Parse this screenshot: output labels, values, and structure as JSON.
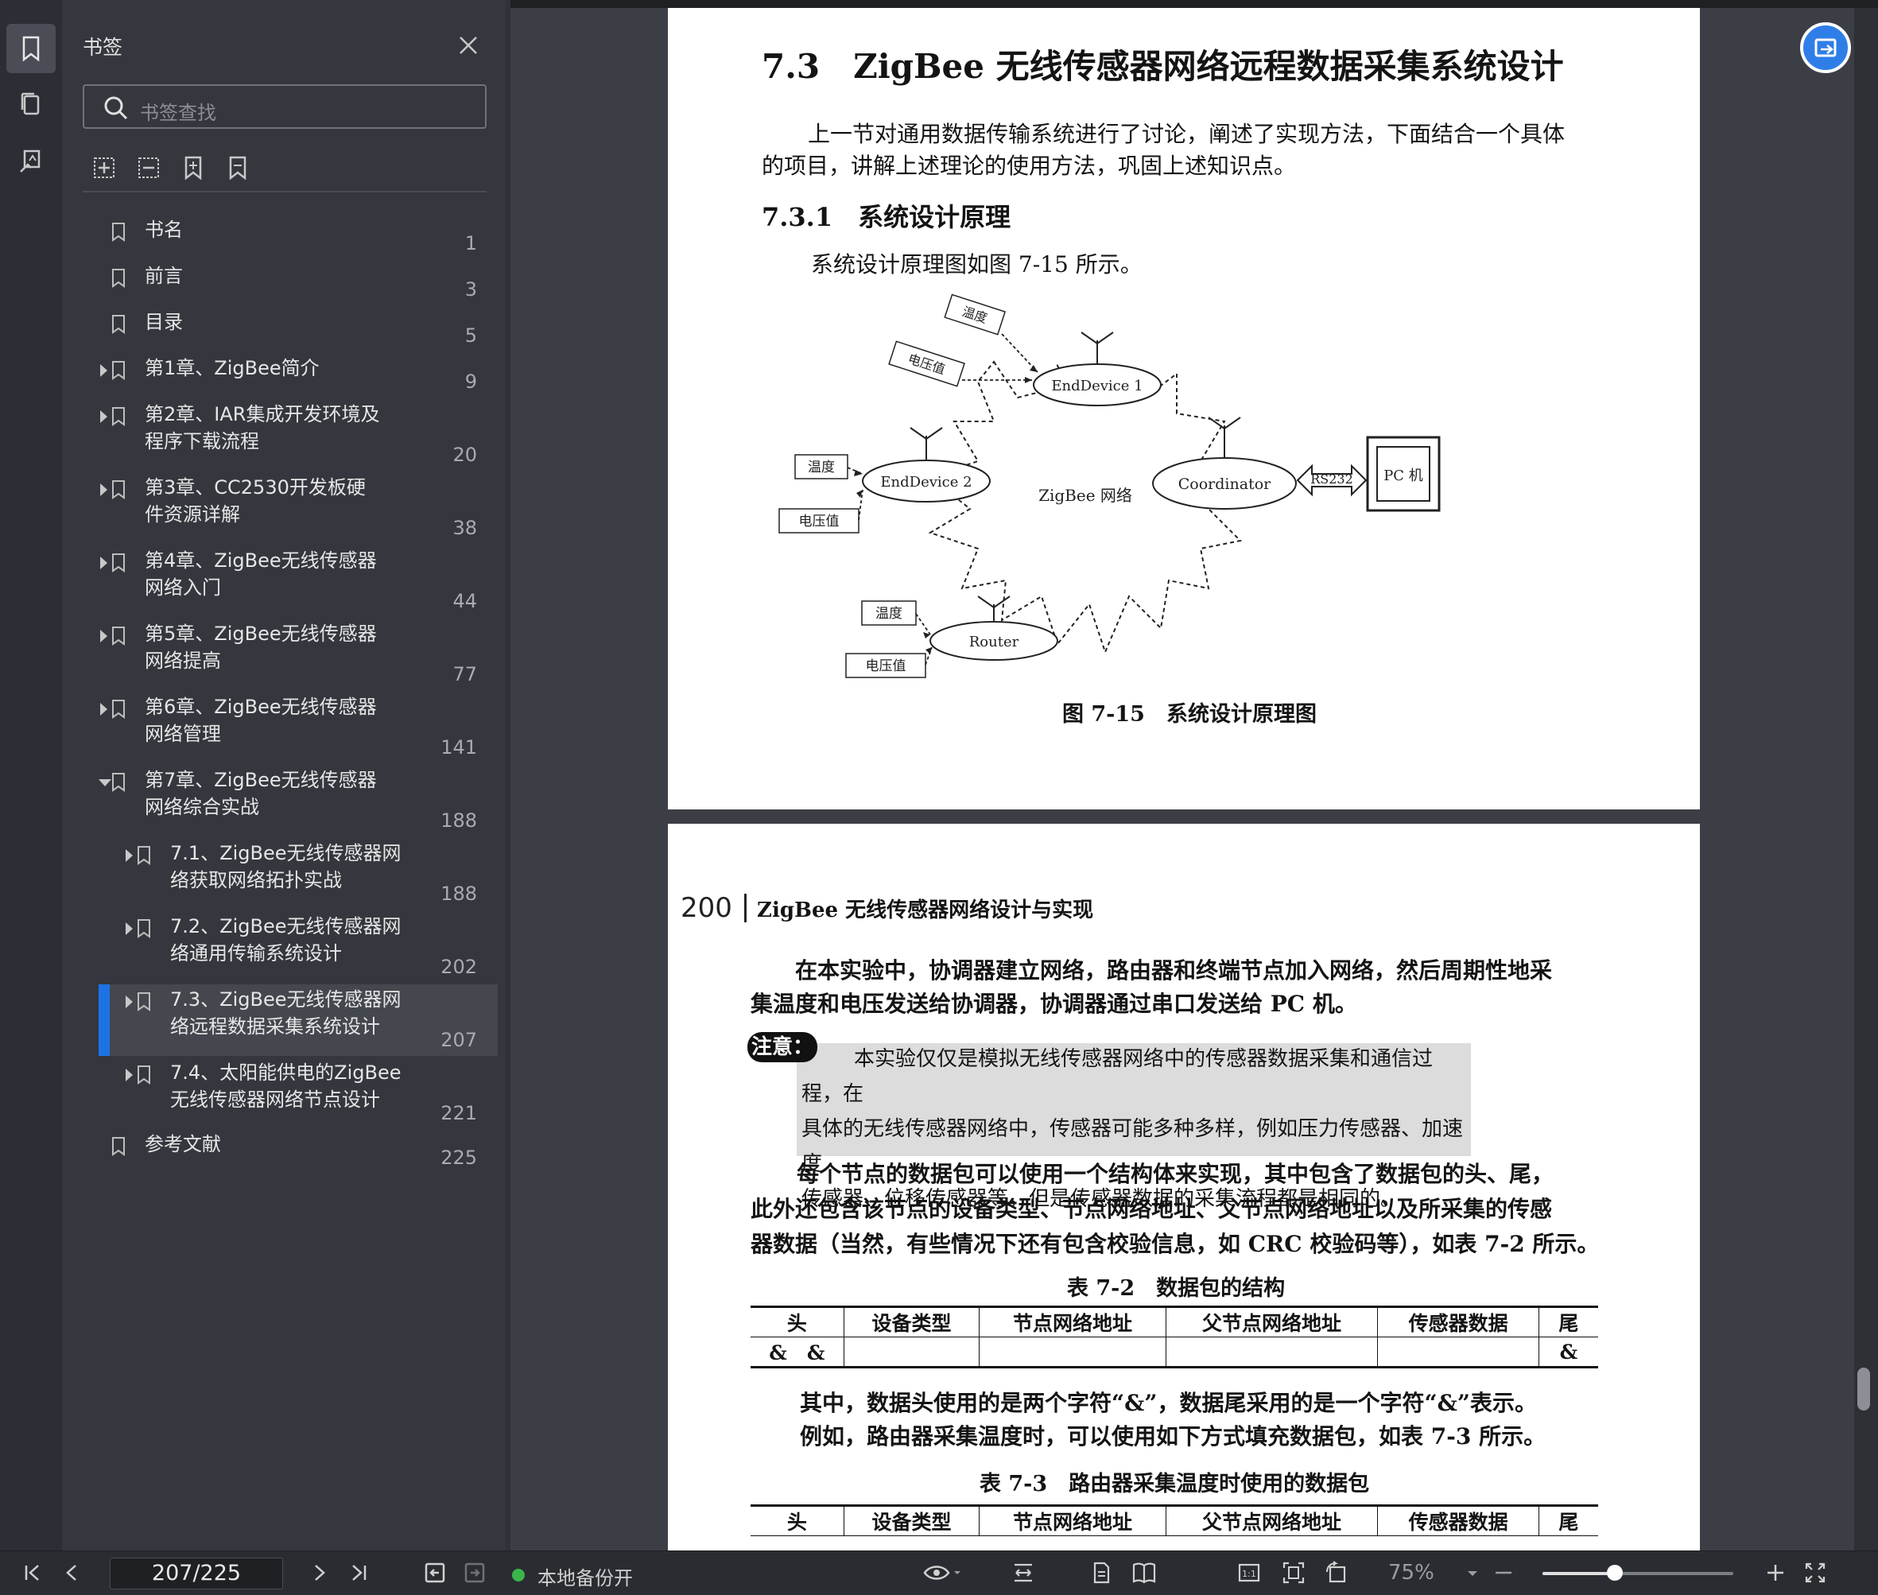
{
  "panel": {
    "title": "书签",
    "search_placeholder": "书签查找"
  },
  "bookmarks": [
    {
      "label": "书名",
      "page": "1",
      "expand": "none",
      "indent": 0
    },
    {
      "label": "前言",
      "page": "3",
      "expand": "none",
      "indent": 0
    },
    {
      "label": "目录",
      "page": "5",
      "expand": "none",
      "indent": 0
    },
    {
      "label": "第1章、ZigBee简介",
      "page": "9",
      "expand": "collapsed",
      "indent": 0
    },
    {
      "label": "第2章、IAR集成开发环境及程序下载流程",
      "page": "20",
      "expand": "collapsed",
      "indent": 0
    },
    {
      "label": "第3章、CC2530开发板硬件资源详解",
      "page": "38",
      "expand": "collapsed",
      "indent": 0
    },
    {
      "label": "第4章、ZigBee无线传感器网络入门",
      "page": "44",
      "expand": "collapsed",
      "indent": 0
    },
    {
      "label": "第5章、ZigBee无线传感器网络提高",
      "page": "77",
      "expand": "collapsed",
      "indent": 0
    },
    {
      "label": "第6章、ZigBee无线传感器网络管理",
      "page": "141",
      "expand": "collapsed",
      "indent": 0
    },
    {
      "label": "第7章、ZigBee无线传感器网络综合实战",
      "page": "188",
      "expand": "expanded",
      "indent": 0
    },
    {
      "label": "7.1、ZigBee无线传感器网络获取网络拓扑实战",
      "page": "188",
      "expand": "collapsed",
      "indent": 1
    },
    {
      "label": "7.2、ZigBee无线传感器网络通用传输系统设计",
      "page": "202",
      "expand": "collapsed",
      "indent": 1
    },
    {
      "label": "7.3、ZigBee无线传感器网络远程数据采集系统设计",
      "page": "207",
      "expand": "collapsed",
      "indent": 1,
      "selected": true
    },
    {
      "label": "7.4、太阳能供电的ZigBee无线传感器网络节点设计",
      "page": "221",
      "expand": "collapsed",
      "indent": 1
    },
    {
      "label": "参考文献",
      "page": "225",
      "expand": "none",
      "indent": 0
    }
  ],
  "doc": {
    "section_title": "7.3　ZigBee 无线传感器网络远程数据采集系统设计",
    "intro_line1": "上一节对通用数据传输系统进行了讨论，阐述了实现方法，下面结合一个具体",
    "intro_line2": "的项目，讲解上述理论的使用方法，巩固上述知识点。",
    "subsection_title": "7.3.1　系统设计原理",
    "fig_ref": "系统设计原理图如图 7-15 所示。",
    "figure": {
      "caption": "图 7-15　系统设计原理图",
      "center": "ZigBee 网络",
      "end1": "EndDevice 1",
      "end2": "EndDevice 2",
      "coordinator": "Coordinator",
      "router": "Router",
      "link": "RS232",
      "pc": "PC 机",
      "temp": "温度",
      "volt": "电压值"
    },
    "running_page": "200",
    "running_title": "ZigBee 无线传感器网络设计与实现",
    "p1_line1": "在本实验中，协调器建立网络，路由器和终端节点加入网络，然后周期性地采",
    "p1_line2": "集温度和电压发送给协调器，协调器通过串口发送给 PC 机。",
    "note_label": "注意：",
    "note_line1": "本实验仅仅是模拟无线传感器网络中的传感器数据采集和通信过程，在",
    "note_line2": "具体的无线传感器网络中，传感器可能多种多样，例如压力传感器、加速度",
    "note_line3": "传感器、位移传感器等，但是传感器数据的采集流程都是相同的。",
    "p2_line1": "每个节点的数据包可以使用一个结构体来实现，其中包含了数据包的头、尾，",
    "p2_line2": "此外还包含该节点的设备类型、节点网络地址、父节点网络地址以及所采集的传感",
    "p2_line3": "器数据（当然，有些情况下还有包含校验信息，如 CRC 校验码等），如表 7-2 所示。",
    "table2_caption": "表 7-2　数据包的结构",
    "table_headers": [
      "头",
      "设备类型",
      "节点网络地址",
      "父节点网络地址",
      "传感器数据",
      "尾"
    ],
    "table2_row": [
      "&　&",
      "",
      "",
      "",
      "",
      "&"
    ],
    "p3_line1": "其中，数据头使用的是两个字符“&”，数据尾采用的是一个字符“&”表示。",
    "p3_line2": "例如，路由器采集温度时，可以使用如下方式填充数据包，如表 7-3 所示。",
    "table3_caption": "表 7-3　路由器采集温度时使用的数据包"
  },
  "bottom": {
    "page_value": "207/225",
    "backup_label": "本地备份开",
    "zoom": "75%",
    "zoom_fraction": 0.38
  }
}
